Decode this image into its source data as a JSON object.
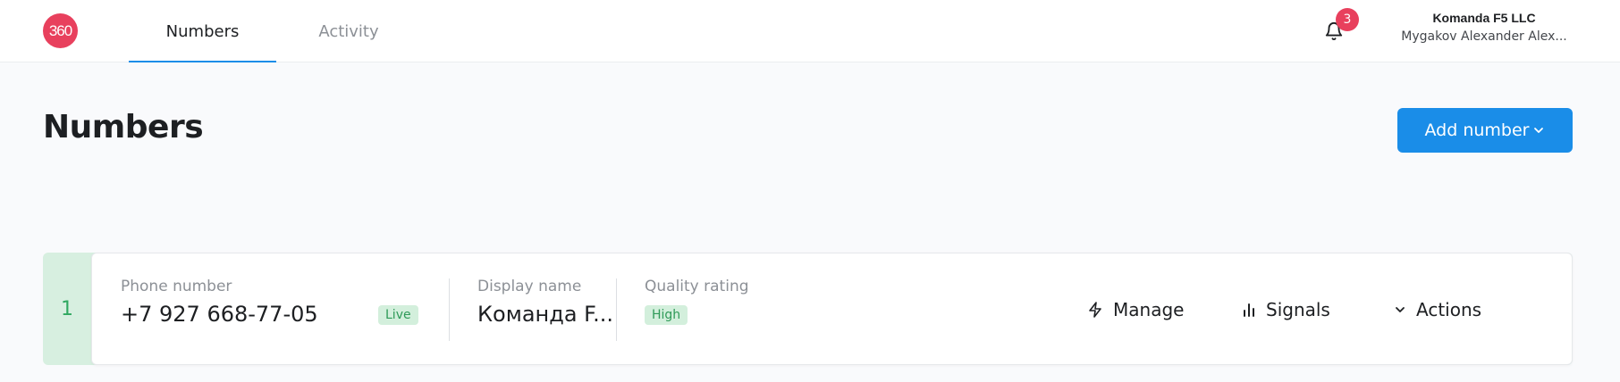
{
  "logo": {
    "text": "360"
  },
  "tabs": [
    {
      "label": "Numbers",
      "active": true
    },
    {
      "label": "Activity",
      "active": false
    }
  ],
  "notifications": {
    "count": "3",
    "icon": "bell-icon"
  },
  "account": {
    "organization": "Komanda F5 LLC",
    "user": "Mygakov Alexander Alex..."
  },
  "page": {
    "title": "Numbers",
    "add_button_label": "Add number"
  },
  "numbers": [
    {
      "index": "1",
      "phone_label": "Phone number",
      "phone": "+7 927 668-77-05",
      "status": "Live",
      "display_name_label": "Display name",
      "display_name": "Команда F...",
      "quality_label": "Quality rating",
      "quality": "High",
      "actions": {
        "manage": "Manage",
        "signals": "Signals",
        "more": "Actions"
      }
    }
  ],
  "colors": {
    "accent": "#1a8de8",
    "brand": "#e8405d",
    "status_green": "#2fa860"
  }
}
